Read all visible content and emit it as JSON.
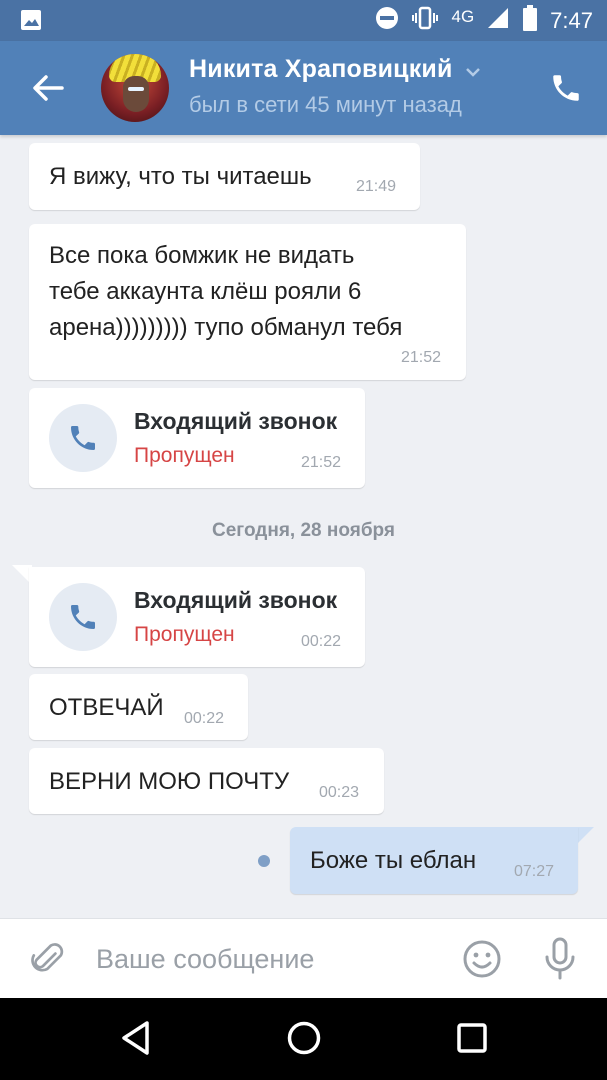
{
  "status_bar": {
    "network": "4G",
    "time": "7:47"
  },
  "header": {
    "name": "Никита Храповицкий",
    "status": "был в сети 45 минут назад"
  },
  "messages": [
    {
      "text": "Я вижу, что ты читаешь",
      "time": "21:49"
    },
    {
      "lines": [
        "Все пока бомжик не видать",
        "тебе аккаунта клёш рояли 6",
        "арена))))))))) тупо обманул тебя"
      ],
      "time": "21:52"
    },
    {
      "call_title": "Входящий звонок",
      "call_status": "Пропущен",
      "time": "21:52"
    },
    {
      "call_title": "Входящий звонок",
      "call_status": "Пропущен",
      "time": "00:22"
    },
    {
      "text": "ОТВЕЧАЙ",
      "time": "00:22"
    },
    {
      "text": "ВЕРНИ МОЮ ПОЧТУ",
      "time": "00:23"
    },
    {
      "text": "Боже ты еблан",
      "time": "07:27"
    }
  ],
  "date_separator": "Сегодня, 28 ноября",
  "input": {
    "placeholder": "Ваше сообщение"
  },
  "icons": {
    "status": [
      "gallery-icon",
      "dnd-icon",
      "vibrate-icon",
      "signal-icon",
      "battery-icon"
    ],
    "header": [
      "back-arrow-icon",
      "chevron-down-icon",
      "phone-icon"
    ],
    "input": [
      "attach-icon",
      "emoji-icon",
      "mic-icon"
    ],
    "nav": [
      "nav-back-icon",
      "nav-home-icon",
      "nav-recents-icon"
    ]
  },
  "colors": {
    "status_bar": "#4a72a4",
    "header": "#5181b8",
    "background": "#eef0f4",
    "outgoing_bubble": "#cfe0f5",
    "missed_call": "#d64545"
  }
}
